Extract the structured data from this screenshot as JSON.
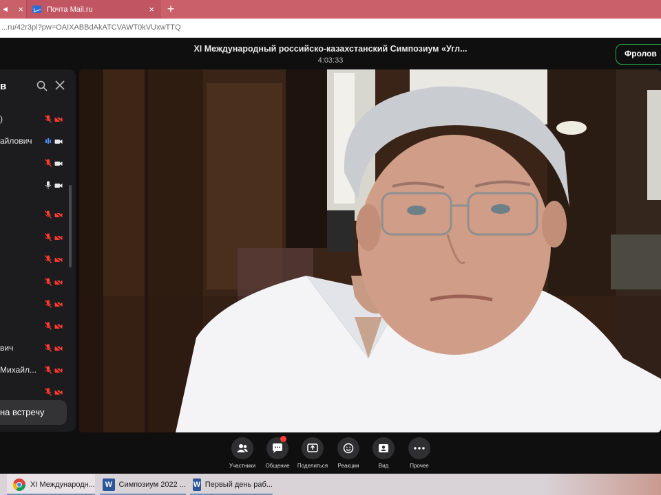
{
  "browser": {
    "tabs": [
      {
        "title": "",
        "active": false
      },
      {
        "title": "Почта Mail.ru",
        "active": true
      }
    ],
    "new_tab_label": "+",
    "close_label": "×",
    "url": "...ru/42r3pl?pw=OAIXABBdAkATCVAWT0kVUxwTTQ"
  },
  "meeting": {
    "title": "XI Международный российско-казахстанский Симпозиум «Угл...",
    "timer": "4:03:33",
    "user_button": "Фролов"
  },
  "participants_panel": {
    "title": "в",
    "rows": [
      {
        "name": ")",
        "mic": "mic-muted-icon",
        "cam": "camera-off-icon"
      },
      {
        "name": "айлович",
        "mic": "mic-speaking-icon",
        "cam": "camera-on-icon"
      },
      {
        "name": "",
        "mic": "mic-muted-icon",
        "cam": "camera-on-icon"
      },
      {
        "name": "",
        "mic": "mic-on-icon",
        "cam": "camera-on-icon"
      },
      {
        "name": "",
        "mic": "mic-muted-icon",
        "cam": "camera-off-icon"
      },
      {
        "name": "",
        "mic": "mic-muted-icon",
        "cam": "camera-off-icon"
      },
      {
        "name": "",
        "mic": "mic-muted-icon",
        "cam": "camera-off-icon"
      },
      {
        "name": "",
        "mic": "mic-muted-icon",
        "cam": "camera-off-icon"
      },
      {
        "name": "",
        "mic": "mic-muted-icon",
        "cam": "camera-off-icon"
      },
      {
        "name": "",
        "mic": "mic-muted-icon",
        "cam": "camera-off-icon"
      },
      {
        "name": "вич",
        "mic": "mic-muted-icon",
        "cam": "camera-off-icon"
      },
      {
        "name": "Михайл...",
        "mic": "mic-muted-icon",
        "cam": "camera-off-icon"
      },
      {
        "name": "",
        "mic": "mic-muted-icon",
        "cam": "camera-off-icon"
      }
    ],
    "join_button": "на встречу"
  },
  "toolbar": {
    "buttons": [
      {
        "label": "Участники",
        "icon": "participants-icon"
      },
      {
        "label": "Общение",
        "icon": "chat-icon"
      },
      {
        "label": "Поделиться",
        "icon": "share-screen-icon"
      },
      {
        "label": "Реакции",
        "icon": "reactions-icon"
      },
      {
        "label": "Вид",
        "icon": "view-icon"
      },
      {
        "label": "Прочее",
        "icon": "more-icon"
      }
    ]
  },
  "taskbar": {
    "items": [
      {
        "label": "XI Международн...",
        "icon": "chrome-icon"
      },
      {
        "label": "Симпозиум 2022 ...",
        "icon": "word-icon"
      },
      {
        "label": "Первый день раб...",
        "icon": "word-icon"
      }
    ],
    "word_glyph": "W"
  },
  "colors": {
    "tab_strip": "#c9606a",
    "muted_red": "#ff3b30",
    "accent_green": "#2aa84a",
    "app_bg": "#0f0f10"
  }
}
